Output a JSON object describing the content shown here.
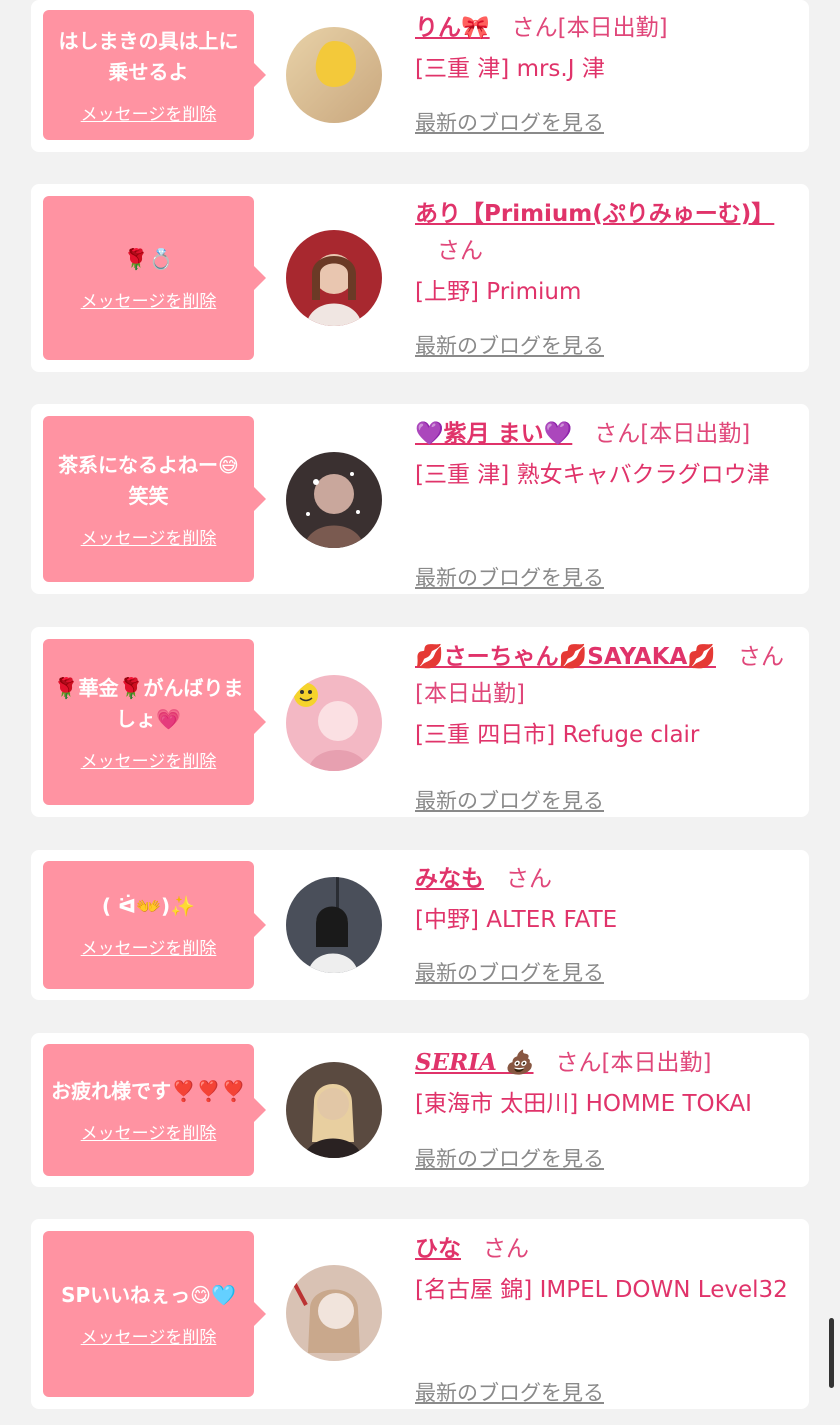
{
  "items": [
    {
      "message": "はしまきの具は上に乗せるよ",
      "delete_label": "メッセージを削除",
      "name": "りん🎀",
      "suffix": "さん[本日出勤]",
      "shop": "[三重 津] mrs.J 津",
      "blog_label": "最新のブログを見る",
      "avatar_colors": [
        "#e8d2a8",
        "#f6e3b8"
      ]
    },
    {
      "message": "🌹💍",
      "delete_label": "メッセージを削除",
      "name": "あり【Primium(ぷりみゅーむ)】",
      "suffix": "さん",
      "shop": "[上野] Primium",
      "blog_label": "最新のブログを見る",
      "avatar_colors": [
        "#a8282f",
        "#e9c6b0"
      ]
    },
    {
      "message": "茶系になるよねー😅笑笑",
      "delete_label": "メッセージを削除",
      "name": "💜紫月 まい💜",
      "suffix": "さん[本日出勤]",
      "shop": "[三重 津] 熟女キャバクラグロウ津",
      "blog_label": "最新のブログを見る",
      "avatar_colors": [
        "#3a3030",
        "#c9a79c"
      ]
    },
    {
      "message": "🌹華金🌹がんばりましょ💗",
      "delete_label": "メッセージを削除",
      "name": "💋さーちゃん💋SAYAKA💋",
      "suffix": "さん[本日出勤]",
      "shop": "[三重 四日市] Refuge clair",
      "blog_label": "最新のブログを見る",
      "avatar_colors": [
        "#f3b8c4",
        "#fbe0e3"
      ]
    },
    {
      "message": "( ᐛ👐)✨",
      "delete_label": "メッセージを削除",
      "name": "みなも",
      "suffix": "さん",
      "shop": "[中野] ALTER FATE",
      "blog_label": "最新のブログを見る",
      "avatar_colors": [
        "#4a4f5a",
        "#d7d3d0"
      ]
    },
    {
      "message": "お疲れ様です❣️❣️❣️",
      "delete_label": "メッセージを削除",
      "name": "SERIA 💩",
      "suffix": "さん[本日出勤]",
      "shop": "[東海市 太田川] HOMME TOKAI",
      "blog_label": "最新のブログを見る",
      "avatar_colors": [
        "#5a4a40",
        "#e2c7a6"
      ]
    },
    {
      "message": "SPいいねぇっ😋🩵",
      "delete_label": "メッセージを削除",
      "name": "ひな",
      "suffix": "さん",
      "shop": "[名古屋 錦] IMPEL DOWN Level32",
      "blog_label": "最新のブログを見る",
      "avatar_colors": [
        "#d9c2b4",
        "#f1e4dc"
      ]
    }
  ]
}
